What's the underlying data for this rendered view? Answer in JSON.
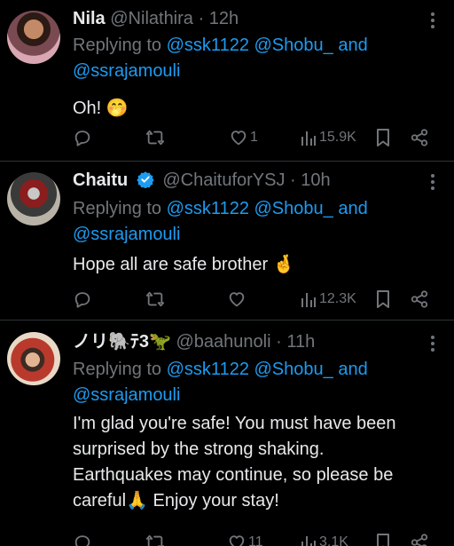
{
  "tweets": [
    {
      "name": "Nila",
      "handle": "@Nilathira",
      "time": "12h",
      "replying_prefix": "Replying to",
      "mention1": "@ssk1122",
      "mention2": "@Shobu_",
      "and_text": "and",
      "mention3": "@ssrajamouli",
      "body": "Oh! 🤭",
      "likes": "1",
      "views": "15.9K",
      "verified": false
    },
    {
      "name": "Chaitu",
      "handle": "@ChaituforYSJ",
      "time": "10h",
      "replying_prefix": "Replying to",
      "mention1": "@ssk1122",
      "mention2": "@Shobu_",
      "and_text": "and",
      "mention3": "@ssrajamouli",
      "body": "Hope all are safe brother 🤞",
      "likes": "",
      "views": "12.3K",
      "verified": true
    },
    {
      "name": "ノリ🐘ﾃ3🦖",
      "handle": "@baahunoli",
      "time": "11h",
      "replying_prefix": "Replying to",
      "mention1": "@ssk1122",
      "mention2": "@Shobu_",
      "and_text": "and",
      "mention3": "@ssrajamouli",
      "body_lines": [
        "I'm glad you're safe! You must have been",
        "surprised by the strong shaking.",
        "Earthquakes may continue, so please be",
        "careful🙏 Enjoy your stay!"
      ],
      "likes": "11",
      "views": "3.1K",
      "verified": false
    }
  ],
  "separator": "·",
  "icons": {
    "reply": "reply-icon",
    "retweet": "retweet-icon",
    "like": "heart-icon",
    "views": "views-chart-icon",
    "bookmark": "bookmark-icon",
    "share": "share-icon",
    "more": "more-dots-icon",
    "verified": "verified-badge-icon"
  },
  "colors": {
    "background": "#000000",
    "text": "#e7e9ea",
    "muted": "#71767b",
    "link": "#1d9bf0",
    "verified": "#1d9bf0"
  }
}
